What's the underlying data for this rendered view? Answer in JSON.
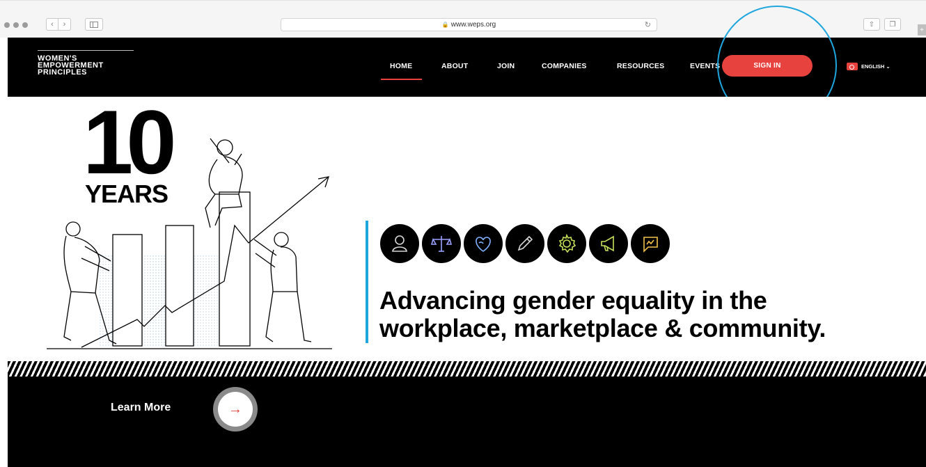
{
  "browser": {
    "url": "www.weps.org",
    "icons": {
      "back": "chevron-left-icon",
      "forward": "chevron-right-icon",
      "sidebar": "sidebar-icon",
      "reload": "reload-icon",
      "share": "share-icon",
      "tabs": "tabs-icon",
      "lock": "lock-icon"
    },
    "back_glyph": "‹",
    "forward_glyph": "›",
    "reload_glyph": "↻",
    "lock_glyph": "🔒",
    "share_glyph": "⇧",
    "tabs_glyph": "❐",
    "plus_glyph": "+"
  },
  "logo": {
    "line1": "WOMEN'S",
    "line2": "EMPOWERMENT",
    "line3": "PRINCIPLES"
  },
  "nav": {
    "items": [
      {
        "label": "HOME",
        "active": true
      },
      {
        "label": "ABOUT",
        "active": false
      },
      {
        "label": "JOIN",
        "active": false
      },
      {
        "label": "COMPANIES",
        "active": false
      },
      {
        "label": "RESOURCES",
        "active": false
      },
      {
        "label": "EVENTS",
        "active": false
      }
    ],
    "signin_label": "SIGN IN",
    "language_label": "ENGLISH ⌄"
  },
  "hero": {
    "number": "10",
    "years_label": "YEARS",
    "tagline_line1": "Advancing gender equality in the",
    "tagline_line2": "workplace, marketplace & community.",
    "principle_icons": [
      {
        "name": "leadership-person-icon",
        "color": "#d8d8d8"
      },
      {
        "name": "equality-scale-icon",
        "color": "#9aa0ff"
      },
      {
        "name": "health-heart-icon",
        "color": "#7fb2ff"
      },
      {
        "name": "education-pencil-icon",
        "color": "#d8d8d8"
      },
      {
        "name": "enterprise-gear-icon",
        "color": "#c6e05a"
      },
      {
        "name": "advocacy-megaphone-icon",
        "color": "#c6e05a"
      },
      {
        "name": "reporting-chat-icon",
        "color": "#f2c24a"
      }
    ]
  },
  "lower": {
    "learn_more_label": "Learn More",
    "arrow_glyph": "→"
  },
  "colors": {
    "accent_red": "#e8423f",
    "accent_blue": "#1ea6de",
    "header_bg": "#000000"
  }
}
